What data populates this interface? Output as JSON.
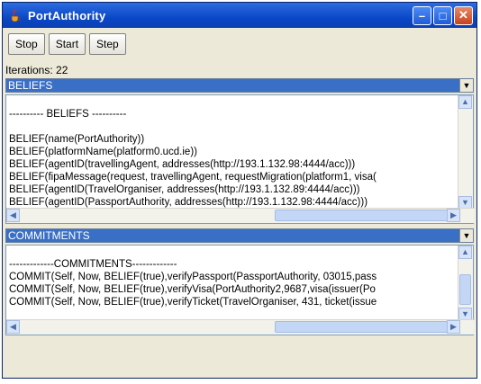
{
  "window": {
    "title": "PortAuthority"
  },
  "titlebar": {
    "minimize_glyph": "–",
    "maximize_glyph": "□",
    "close_glyph": "✕"
  },
  "toolbar": {
    "stop_label": "Stop",
    "start_label": "Start",
    "step_label": "Step"
  },
  "status": {
    "iterations": "Iterations: 22"
  },
  "beliefs": {
    "selector_value": "BELIEFS",
    "lines": [
      "",
      "---------- BELIEFS ----------",
      "",
      "BELIEF(name(PortAuthority))",
      "BELIEF(platformName(platform0.ucd.ie))",
      "BELIEF(agentID(travellingAgent, addresses(http://193.1.132.98:4444/acc)))",
      "BELIEF(fipaMessage(request, travellingAgent, requestMigration(platform1, visa(",
      "BELIEF(agentID(TravelOrganiser, addresses(http://193.1.132.89:4444/acc)))",
      "BELIEF(agentID(PassportAuthority, addresses(http://193.1.132.98:4444/acc)))"
    ]
  },
  "commitments": {
    "selector_value": "COMMITMENTS",
    "lines": [
      "",
      "-------------COMMITMENTS-------------",
      "COMMIT(Self, Now, BELIEF(true),verifyPassport(PassportAuthority, 03015,pass",
      "COMMIT(Self, Now, BELIEF(true),verifyVisa(PortAuthority2,9687,visa(issuer(Po",
      "COMMIT(Self, Now, BELIEF(true),verifyTicket(TravelOrganiser, 431, ticket(issue"
    ]
  },
  "scroll": {
    "up": "▲",
    "down": "▼",
    "left": "◀",
    "right": "▶",
    "combo": "▼"
  },
  "icons": {
    "app": "java-cup-icon"
  }
}
